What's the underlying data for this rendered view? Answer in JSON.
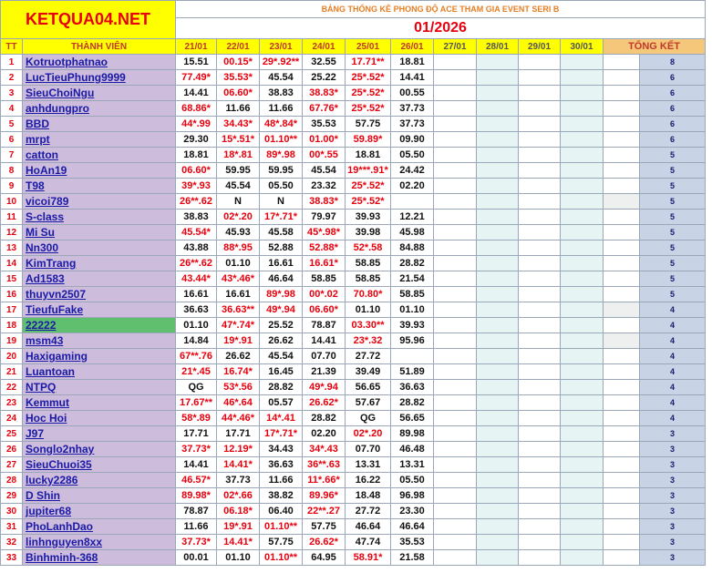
{
  "brand": "KETQUA04.NET",
  "title": "BẢNG THỐNG KÊ PHONG ĐỘ ACE THAM GIA EVENT SERI B",
  "month": "01/2026",
  "headers": {
    "tt": "TT",
    "member": "THÀNH VIÊN",
    "days": [
      "21/01",
      "22/01",
      "23/01",
      "24/01",
      "25/01",
      "26/01",
      "27/01",
      "28/01",
      "29/01",
      "30/01"
    ],
    "total": "TỔNG KẾT"
  },
  "colors": {
    "brand": "#e8000d",
    "header_bg": "#ffff00",
    "name_bg": "#cdbcdc",
    "highlight": "#5fbf6f",
    "miss": "#e8000d"
  },
  "rows": [
    {
      "tt": "1",
      "name": "Kotruotphatnao",
      "scores": [
        "15.51",
        "00.15*",
        "29*.92**",
        "32.55",
        "17.71**",
        "18.81"
      ],
      "total": "8"
    },
    {
      "tt": "2",
      "name": "LucTieuPhung9999",
      "scores": [
        "77.49*",
        "35.53*",
        "45.54",
        "25.22",
        "25*.52*",
        "14.41"
      ],
      "total": "6"
    },
    {
      "tt": "3",
      "name": "SieuChoiNgu",
      "scores": [
        "14.41",
        "06.60*",
        "38.83",
        "38.83*",
        "25*.52*",
        "00.55"
      ],
      "total": "6"
    },
    {
      "tt": "4",
      "name": "anhdungpro",
      "scores": [
        "68.86*",
        "11.66",
        "11.66",
        "67.76*",
        "25*.52*",
        "37.73"
      ],
      "total": "6"
    },
    {
      "tt": "5",
      "name": "BBD",
      "scores": [
        "44*.99",
        "34.43*",
        "48*.84*",
        "35.53",
        "57.75",
        "37.73"
      ],
      "total": "6"
    },
    {
      "tt": "6",
      "name": "mrpt",
      "scores": [
        "29.30",
        "15*.51*",
        "01.10**",
        "01.00*",
        "59.89*",
        "09.90"
      ],
      "total": "6"
    },
    {
      "tt": "7",
      "name": "catton",
      "scores": [
        "18.81",
        "18*.81",
        "89*.98",
        "00*.55",
        "18.81",
        "05.50"
      ],
      "total": "5"
    },
    {
      "tt": "8",
      "name": "HoAn19",
      "scores": [
        "06.60*",
        "59.95",
        "59.95",
        "45.54",
        "19***.91*",
        "24.42"
      ],
      "total": "5"
    },
    {
      "tt": "9",
      "name": "T98",
      "scores": [
        "39*.93",
        "45.54",
        "05.50",
        "23.32",
        "25*.52*",
        "02.20"
      ],
      "total": "5"
    },
    {
      "tt": "10",
      "name": "vicoi789",
      "scores": [
        "26**.62",
        "N",
        "N",
        "38.83*",
        "25*.52*",
        ""
      ],
      "total": "5"
    },
    {
      "tt": "11",
      "name": "S-class",
      "scores": [
        "38.83",
        "02*.20",
        "17*.71*",
        "79.97",
        "39.93",
        "12.21"
      ],
      "total": "5"
    },
    {
      "tt": "12",
      "name": "Mi Su",
      "scores": [
        "45.54*",
        "45.93",
        "45.58",
        "45*.98*",
        "39.98",
        "45.98"
      ],
      "total": "5"
    },
    {
      "tt": "13",
      "name": "Nn300",
      "scores": [
        "43.88",
        "88*.95",
        "52.88",
        "52.88*",
        "52*.58",
        "84.88"
      ],
      "total": "5"
    },
    {
      "tt": "14",
      "name": "KimTrang",
      "scores": [
        "26**.62",
        "01.10",
        "16.61",
        "16.61*",
        "58.85",
        "28.82"
      ],
      "total": "5"
    },
    {
      "tt": "15",
      "name": "Ad1583",
      "scores": [
        "43.44*",
        "43*.46*",
        "46.64",
        "58.85",
        "58.85",
        "21.54"
      ],
      "total": "5"
    },
    {
      "tt": "16",
      "name": "thuyvn2507",
      "scores": [
        "16.61",
        "16.61",
        "89*.98",
        "00*.02",
        "70.80*",
        "58.85"
      ],
      "total": "5"
    },
    {
      "tt": "17",
      "name": "TieufuFake",
      "scores": [
        "36.63",
        "36.63**",
        "49*.94",
        "06.60*",
        "01.10",
        "01.10"
      ],
      "total": "4"
    },
    {
      "tt": "18",
      "name": "22222",
      "scores": [
        "01.10",
        "47*.74*",
        "25.52",
        "78.87",
        "03.30**",
        "39.93"
      ],
      "total": "4",
      "highlight": true
    },
    {
      "tt": "19",
      "name": "msm43",
      "scores": [
        "14.84",
        "19*.91",
        "26.62",
        "14.41",
        "23*.32",
        "95.96"
      ],
      "total": "4"
    },
    {
      "tt": "20",
      "name": "Haxigaming",
      "scores": [
        "67**.76",
        "26.62",
        "45.54",
        "07.70",
        "27.72",
        ""
      ],
      "total": "4"
    },
    {
      "tt": "21",
      "name": "Luantoan",
      "scores": [
        "21*.45",
        "16.74*",
        "16.45",
        "21.39",
        "39.49",
        "51.89"
      ],
      "total": "4"
    },
    {
      "tt": "22",
      "name": "NTPQ",
      "scores": [
        "QG",
        "53*.56",
        "28.82",
        "49*.94",
        "56.65",
        "36.63"
      ],
      "total": "4"
    },
    {
      "tt": "23",
      "name": "Kemmut",
      "scores": [
        "17.67**",
        "46*.64",
        "05.57",
        "26.62*",
        "57.67",
        "28.82"
      ],
      "total": "4"
    },
    {
      "tt": "24",
      "name": "Hoc Hoi",
      "scores": [
        "58*.89",
        "44*.46*",
        "14*.41",
        "28.82",
        "QG",
        "56.65"
      ],
      "total": "4"
    },
    {
      "tt": "25",
      "name": "J97",
      "scores": [
        "17.71",
        "17.71",
        "17*.71*",
        "02.20",
        "02*.20",
        "89.98"
      ],
      "total": "3"
    },
    {
      "tt": "26",
      "name": "Songlo2nhay",
      "scores": [
        "37.73*",
        "12.19*",
        "34.43",
        "34*.43",
        "07.70",
        "46.48"
      ],
      "total": "3"
    },
    {
      "tt": "27",
      "name": "SieuChuoi35",
      "scores": [
        "14.41",
        "14.41*",
        "36.63",
        "36**.63",
        "13.31",
        "13.31"
      ],
      "total": "3"
    },
    {
      "tt": "28",
      "name": "lucky2286",
      "scores": [
        "46.57*",
        "37.73",
        "11.66",
        "11*.66*",
        "16.22",
        "05.50"
      ],
      "total": "3"
    },
    {
      "tt": "29",
      "name": "D Shin",
      "scores": [
        "89.98*",
        "02*.66",
        "38.82",
        "89.96*",
        "18.48",
        "96.98"
      ],
      "total": "3"
    },
    {
      "tt": "30",
      "name": "jupiter68",
      "scores": [
        "78.87",
        "06.18*",
        "06.40",
        "22**.27",
        "27.72",
        "23.30"
      ],
      "total": "3"
    },
    {
      "tt": "31",
      "name": "PhoLanhDao",
      "scores": [
        "11.66",
        "19*.91",
        "01.10**",
        "57.75",
        "46.64",
        "46.64"
      ],
      "total": "3"
    },
    {
      "tt": "32",
      "name": "linhnguyen8xx",
      "scores": [
        "37.73*",
        "14.41*",
        "57.75",
        "26.62*",
        "47.74",
        "35.53"
      ],
      "total": "3"
    },
    {
      "tt": "33",
      "name": "Binhminh-368",
      "scores": [
        "00.01",
        "01.10",
        "01.10**",
        "64.95",
        "58.91*",
        "21.58"
      ],
      "total": "3"
    }
  ]
}
